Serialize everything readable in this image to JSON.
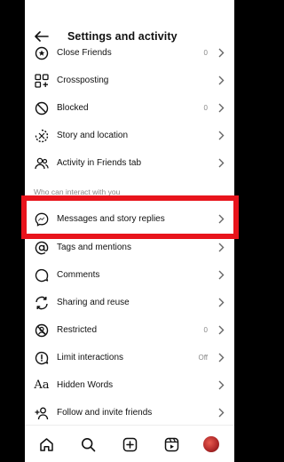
{
  "header": {
    "title": "Settings and activity"
  },
  "section_label": "Who can interact with you",
  "rows": [
    {
      "label": "Close Friends",
      "value": "0",
      "icon": "close-friends-icon"
    },
    {
      "label": "Crossposting",
      "value": "",
      "icon": "crossposting-icon"
    },
    {
      "label": "Blocked",
      "value": "0",
      "icon": "blocked-icon"
    },
    {
      "label": "Story and location",
      "value": "",
      "icon": "story-location-icon"
    },
    {
      "label": "Activity in Friends tab",
      "value": "",
      "icon": "activity-icon"
    },
    {
      "label": "Messages and story replies",
      "value": "",
      "icon": "messenger-icon"
    },
    {
      "label": "Tags and mentions",
      "value": "",
      "icon": "at-icon"
    },
    {
      "label": "Comments",
      "value": "",
      "icon": "comment-icon"
    },
    {
      "label": "Sharing and reuse",
      "value": "",
      "icon": "share-reuse-icon"
    },
    {
      "label": "Restricted",
      "value": "0",
      "icon": "restricted-icon"
    },
    {
      "label": "Limit interactions",
      "value": "Off",
      "icon": "limit-icon"
    },
    {
      "label": "Hidden Words",
      "value": "",
      "icon": "hidden-words-icon"
    },
    {
      "label": "Follow and invite friends",
      "value": "",
      "icon": "add-friend-icon"
    }
  ],
  "bottom_nav": [
    "home-icon",
    "search-icon",
    "create-icon",
    "reels-icon",
    "profile-avatar"
  ],
  "colors": {
    "highlight": "#e8141c",
    "text": "#111111",
    "muted": "#888888"
  }
}
